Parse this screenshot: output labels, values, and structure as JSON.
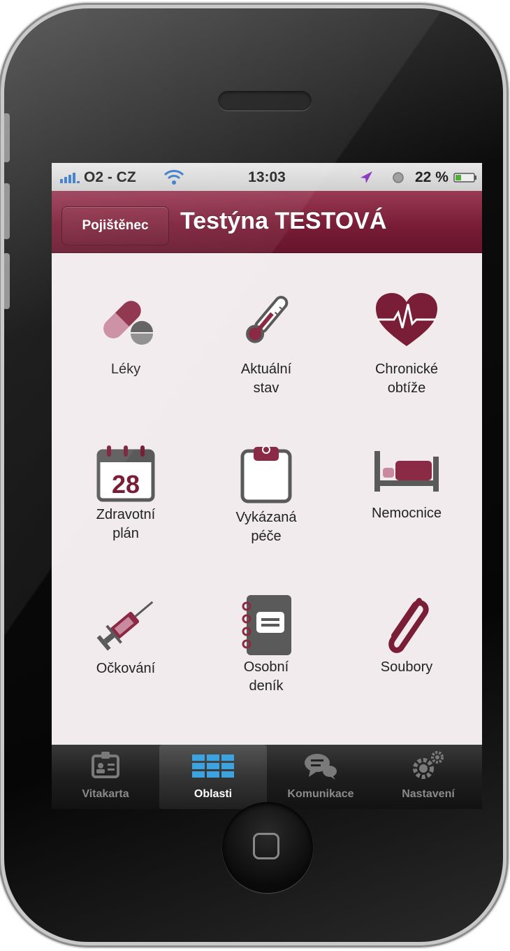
{
  "status_bar": {
    "carrier": "O2 - CZ",
    "time": "13:03",
    "battery": "22 %"
  },
  "nav": {
    "back_label": "Pojištěnec",
    "title": "Testýna TESTOVÁ"
  },
  "grid": {
    "items": [
      {
        "label": "Léky",
        "icon": "pill-icon"
      },
      {
        "label": "Aktuální\nstav",
        "icon": "thermometer-icon"
      },
      {
        "label": "Chronické\nobtíže",
        "icon": "heart-pulse-icon"
      },
      {
        "label": "Zdravotní\nplán",
        "icon": "calendar-icon",
        "icon_text": "28"
      },
      {
        "label": "Vykázaná\npéče",
        "icon": "clipboard-icon"
      },
      {
        "label": "Nemocnice",
        "icon": "hospital-bed-icon"
      },
      {
        "label": "Očkování",
        "icon": "syringe-icon"
      },
      {
        "label": "Osobní\ndeník",
        "icon": "notebook-icon"
      },
      {
        "label": "Soubory",
        "icon": "paperclip-icon"
      }
    ]
  },
  "tab_bar": {
    "tabs": [
      {
        "label": "Vitakarta",
        "icon": "id-card-icon",
        "active": false
      },
      {
        "label": "Oblasti",
        "icon": "grid-icon",
        "active": true
      },
      {
        "label": "Komunikace",
        "icon": "chat-icon",
        "active": false
      },
      {
        "label": "Nastavení",
        "icon": "gears-icon",
        "active": false
      }
    ]
  },
  "colors": {
    "accent": "#7a1d37",
    "icon_primary": "#8a2a45",
    "icon_secondary": "#5a5a5a",
    "background": "#f2ebee"
  }
}
